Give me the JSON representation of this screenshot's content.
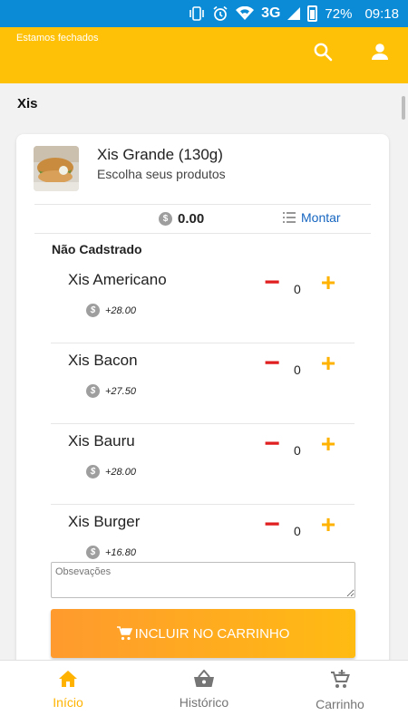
{
  "statusbar": {
    "network": "3G",
    "battery": "72%",
    "time": "09:18"
  },
  "header": {
    "status_text": "Estamos fechados",
    "search_icon": "search-icon",
    "user_icon": "user-icon"
  },
  "section": {
    "title": "Xis"
  },
  "product": {
    "name": "Xis Grande (130g)",
    "subtitle": "Escolha seus produtos",
    "total": "0.00",
    "montar_label": "Montar"
  },
  "group": {
    "title": "Não Cadstrado",
    "items": [
      {
        "name": "Xis Americano",
        "price": "+28.00",
        "qty": "0"
      },
      {
        "name": "Xis Bacon",
        "price": "+27.50",
        "qty": "0"
      },
      {
        "name": "Xis Bauru",
        "price": "+28.00",
        "qty": "0"
      },
      {
        "name": "Xis Burger",
        "price": "+16.80",
        "qty": "0"
      }
    ]
  },
  "observacoes": {
    "placeholder": "Obsevações"
  },
  "cta": {
    "label": "INCLUIR NO CARRINHO"
  },
  "nav": {
    "items": [
      {
        "label": "Início",
        "icon": "home-icon",
        "active": true
      },
      {
        "label": "Histórico",
        "icon": "basket-icon",
        "active": false
      },
      {
        "label": "Carrinho",
        "icon": "cart-icon",
        "active": false
      }
    ]
  },
  "colors": {
    "primary": "#ffc107",
    "statusbar": "#0b8bd6",
    "accent": "#ffb300",
    "minus": "#e02020",
    "link": "#1565c0"
  }
}
